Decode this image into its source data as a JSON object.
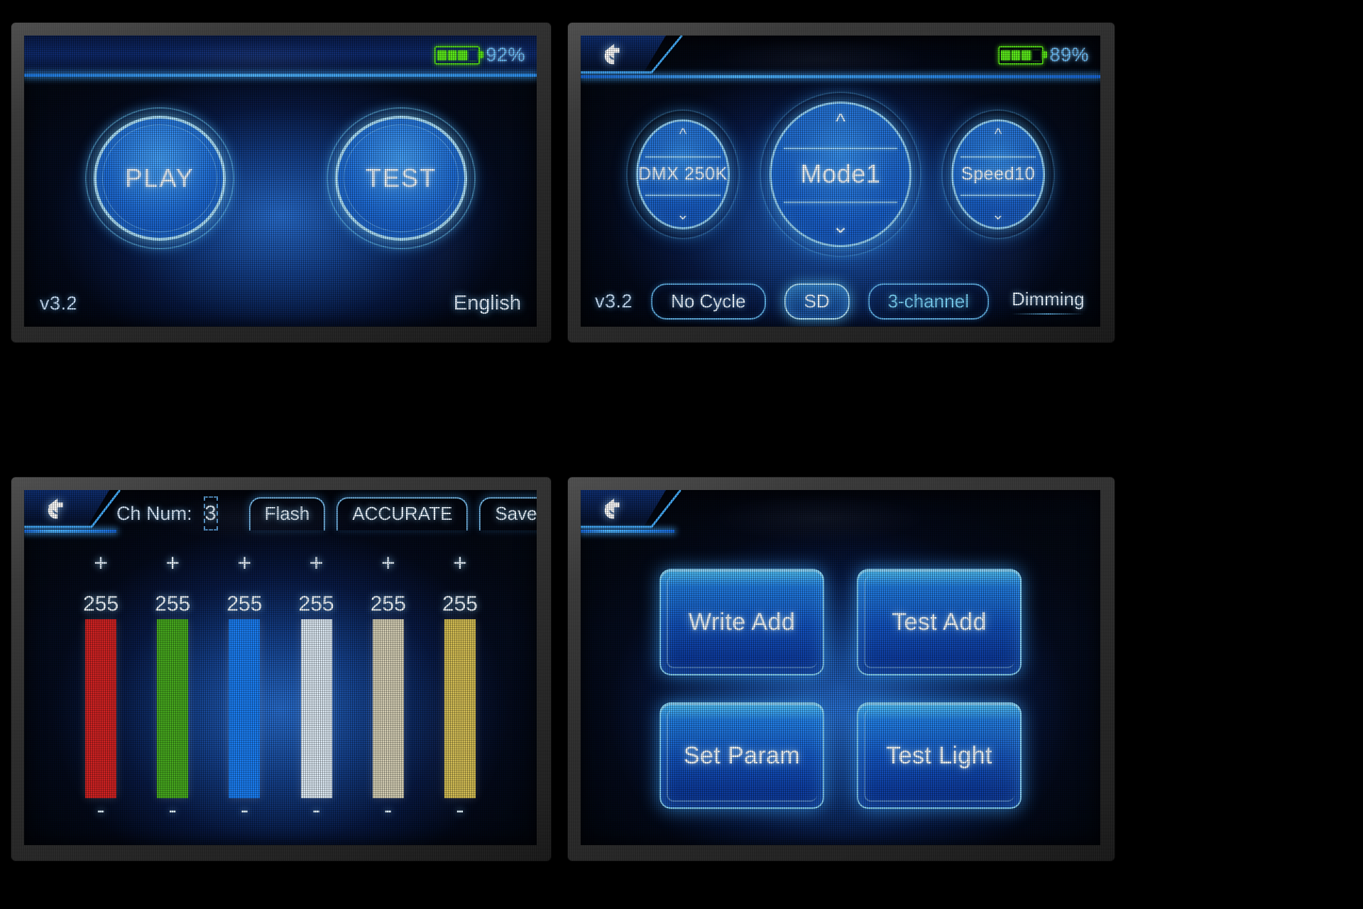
{
  "panel1": {
    "status": {
      "battery_percent": "92%",
      "battery_level": 4
    },
    "buttons": [
      {
        "label": "PLAY",
        "name": "play-button"
      },
      {
        "label": "TEST",
        "name": "test-button"
      }
    ],
    "footer": {
      "version": "v3.2",
      "language": "English"
    }
  },
  "panel2": {
    "status": {
      "battery_percent": "89%",
      "battery_level": 4
    },
    "back_icon": "back-arrow-icon",
    "dials": [
      {
        "label": "DMX 250K",
        "name": "dmx-rate-dial",
        "size": "small"
      },
      {
        "label": "Mode1",
        "name": "mode-dial",
        "size": "big"
      },
      {
        "label": "Speed10",
        "name": "speed-dial",
        "size": "small"
      }
    ],
    "footer": {
      "version": "v3.2",
      "pills": [
        {
          "label": "No Cycle",
          "name": "cycle-mode-pill",
          "style": "outline"
        },
        {
          "label": "SD",
          "name": "source-sd-pill",
          "style": "selected"
        },
        {
          "label": "3-channel",
          "name": "channel-count-pill",
          "style": "cyan"
        },
        {
          "label": "Dimming",
          "name": "dimming-pill",
          "style": "plain"
        }
      ]
    }
  },
  "panel3": {
    "back_icon": "back-arrow-icon",
    "ch_num_label": "Ch Num:",
    "ch_num_value": "3",
    "tabs": [
      {
        "label": "Flash",
        "name": "flash-button"
      },
      {
        "label": "ACCURATE",
        "name": "accurate-button"
      },
      {
        "label": "Save",
        "name": "save-button"
      }
    ],
    "increment_symbol": "+",
    "decrement_symbol": "-",
    "channels": [
      {
        "name": "channel-red",
        "value": "255",
        "color": "#cf2222"
      },
      {
        "name": "channel-green",
        "value": "255",
        "color": "#46a81e"
      },
      {
        "name": "channel-blue",
        "value": "255",
        "color": "#1a7cf0"
      },
      {
        "name": "channel-white",
        "value": "255",
        "color": "#dce9f4"
      },
      {
        "name": "channel-warm-white",
        "value": "255",
        "color": "#d4ceb4"
      },
      {
        "name": "channel-amber",
        "value": "255",
        "color": "#d2bc52"
      }
    ]
  },
  "panel4": {
    "back_icon": "back-arrow-icon",
    "buttons": [
      {
        "label": "Write Add",
        "name": "write-address-button"
      },
      {
        "label": "Test Add",
        "name": "test-address-button"
      },
      {
        "label": "Set Param",
        "name": "set-param-button"
      },
      {
        "label": "Test Light",
        "name": "test-light-button"
      }
    ]
  }
}
